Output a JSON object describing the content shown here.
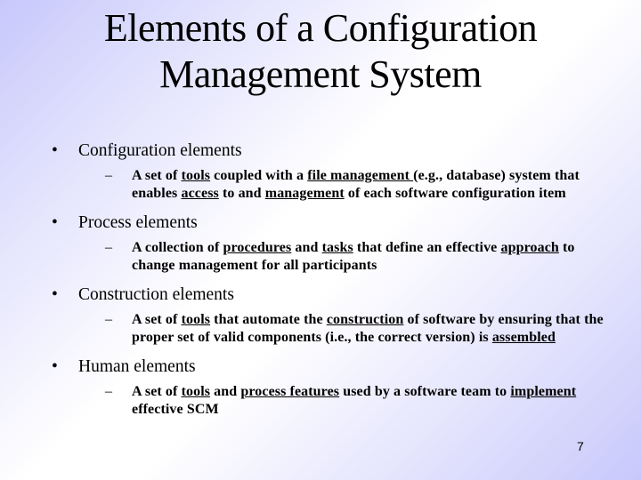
{
  "title": {
    "line1": "Elements of a Configuration",
    "line2": "Management System"
  },
  "bullets": [
    {
      "heading": "Configuration elements",
      "detail": [
        {
          "t": "A set of ",
          "u": false
        },
        {
          "t": "tools",
          "u": true
        },
        {
          "t": " coupled with a ",
          "u": false
        },
        {
          "t": "file management ",
          "u": true
        },
        {
          "t": "(e.g., database) system that enables ",
          "u": false
        },
        {
          "t": "access",
          "u": true
        },
        {
          "t": " to and ",
          "u": false
        },
        {
          "t": "management",
          "u": true
        },
        {
          "t": " of each software configuration item",
          "u": false
        }
      ]
    },
    {
      "heading": "Process elements",
      "detail": [
        {
          "t": "A collection of ",
          "u": false
        },
        {
          "t": "procedures",
          "u": true
        },
        {
          "t": " and ",
          "u": false
        },
        {
          "t": "tasks",
          "u": true
        },
        {
          "t": " that define an effective ",
          "u": false
        },
        {
          "t": "approach",
          "u": true
        },
        {
          "t": " to change management for all participants",
          "u": false
        }
      ]
    },
    {
      "heading": "Construction elements",
      "detail": [
        {
          "t": "A set of ",
          "u": false
        },
        {
          "t": "tools",
          "u": true
        },
        {
          "t": " that automate the ",
          "u": false
        },
        {
          "t": "construction",
          "u": true
        },
        {
          "t": " of software by ensuring that the proper set of valid components (i.e., the correct version) is ",
          "u": false
        },
        {
          "t": "assembled",
          "u": true
        }
      ]
    },
    {
      "heading": "Human elements",
      "detail": [
        {
          "t": "A set of ",
          "u": false
        },
        {
          "t": "tools",
          "u": true
        },
        {
          "t": " and ",
          "u": false
        },
        {
          "t": "process features",
          "u": true
        },
        {
          "t": " used by a software team to ",
          "u": false
        },
        {
          "t": "implement",
          "u": true
        },
        {
          "t": " effective SCM",
          "u": false
        }
      ]
    }
  ],
  "symbols": {
    "bullet": "•",
    "dash": "–"
  },
  "page_number": "7"
}
